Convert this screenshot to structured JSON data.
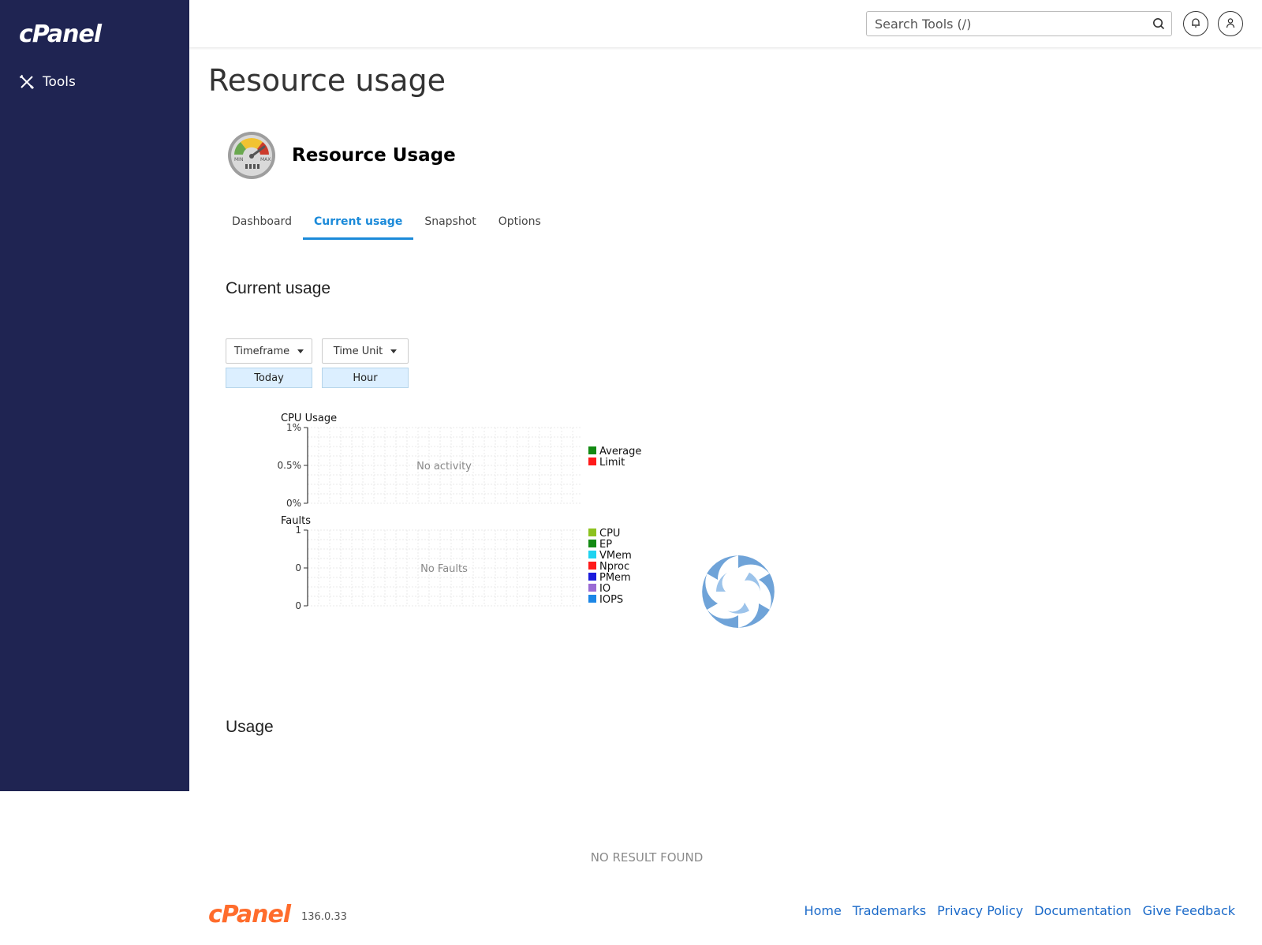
{
  "brand": {
    "logo_text": "cPanel",
    "version": "136.0.33"
  },
  "sidebar": {
    "items": [
      {
        "label": "Tools",
        "icon": "tools-icon"
      }
    ]
  },
  "header": {
    "search_placeholder": "Search Tools (/)"
  },
  "page": {
    "title": "Resource usage",
    "app_title": "Resource Usage",
    "tabs": [
      {
        "label": "Dashboard",
        "active": false
      },
      {
        "label": "Current usage",
        "active": true
      },
      {
        "label": "Snapshot",
        "active": false
      },
      {
        "label": "Options",
        "active": false
      }
    ],
    "section_current": "Current usage",
    "section_usage": "Usage",
    "timeframe_label": "Timeframe",
    "timeframe_value": "Today",
    "timeunit_label": "Time Unit",
    "timeunit_value": "Hour",
    "no_result": "NO RESULT FOUND"
  },
  "chart_data": [
    {
      "type": "line",
      "title": "CPU Usage",
      "yticks": [
        "1%",
        "0.5%",
        "0%"
      ],
      "ylim": [
        0,
        1
      ],
      "empty_message": "No activity",
      "series": [
        {
          "name": "Average",
          "color": "#138a13",
          "values": []
        },
        {
          "name": "Limit",
          "color": "#ff1a1a",
          "values": []
        }
      ],
      "grid": true,
      "legend": "right"
    },
    {
      "type": "line",
      "title": "Faults",
      "yticks": [
        "1",
        "0",
        "0"
      ],
      "ylim": [
        0,
        1
      ],
      "empty_message": "No Faults",
      "series": [
        {
          "name": "CPU",
          "color": "#8dc21f",
          "values": []
        },
        {
          "name": "EP",
          "color": "#138a13",
          "values": []
        },
        {
          "name": "VMem",
          "color": "#1ed3f0",
          "values": []
        },
        {
          "name": "Nproc",
          "color": "#ff1a1a",
          "values": []
        },
        {
          "name": "PMem",
          "color": "#1b1bdc",
          "values": []
        },
        {
          "name": "IO",
          "color": "#9a6bd4",
          "values": []
        },
        {
          "name": "IOPS",
          "color": "#1b86e6",
          "values": []
        }
      ],
      "grid": true,
      "legend": "right"
    }
  ],
  "footer": {
    "links": [
      "Home",
      "Trademarks",
      "Privacy Policy",
      "Documentation",
      "Give Feedback"
    ]
  },
  "colors": {
    "sidebar": "#1f2452",
    "accent": "#1b8ad9",
    "footer_logo": "#ff6c2c"
  }
}
